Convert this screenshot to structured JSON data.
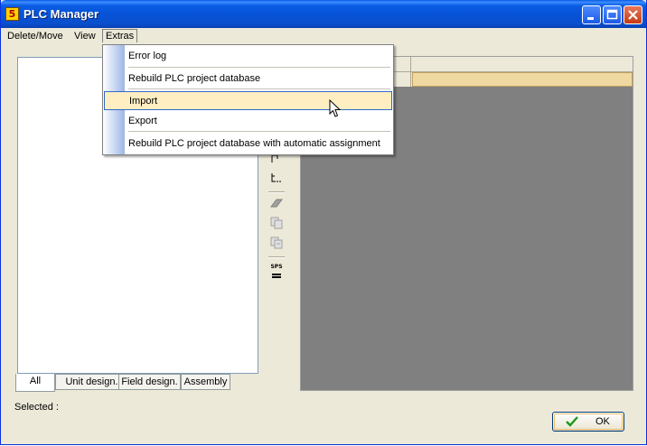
{
  "window": {
    "title": "PLC Manager",
    "app_icon_glyph": "5",
    "controls": {
      "minimize": "minimize-icon",
      "maximize": "maximize-icon",
      "close": "close-icon"
    }
  },
  "menubar": {
    "items": [
      {
        "label": "Delete/Move"
      },
      {
        "label": "View"
      },
      {
        "label": "Extras"
      }
    ]
  },
  "extras_menu": {
    "items": [
      {
        "label": "Error log"
      },
      {
        "label": "Rebuild PLC project database"
      },
      {
        "label": "Import"
      },
      {
        "label": "Export"
      },
      {
        "label": "Rebuild PLC project database with automatic  assignment"
      }
    ],
    "highlighted_item": "Import"
  },
  "tree_tabs": [
    {
      "label": "All"
    },
    {
      "label": "Unit design."
    },
    {
      "label": "Field design."
    },
    {
      "label": "Assembly"
    }
  ],
  "toolbar_icons": [
    "hierarchy-icon",
    "tree-indent-icon",
    "eraser-icon",
    "copy-icon",
    "paste-icon",
    "sps-icon"
  ],
  "sps_label": "SPS",
  "footer": {
    "selected_label": "Selected :",
    "ok_label": "OK"
  },
  "colors": {
    "title_bar": "#0a5de4",
    "grid_background": "#808080",
    "highlight_cell": "#f0d9a0",
    "menu_hover": "#ffeec2"
  }
}
